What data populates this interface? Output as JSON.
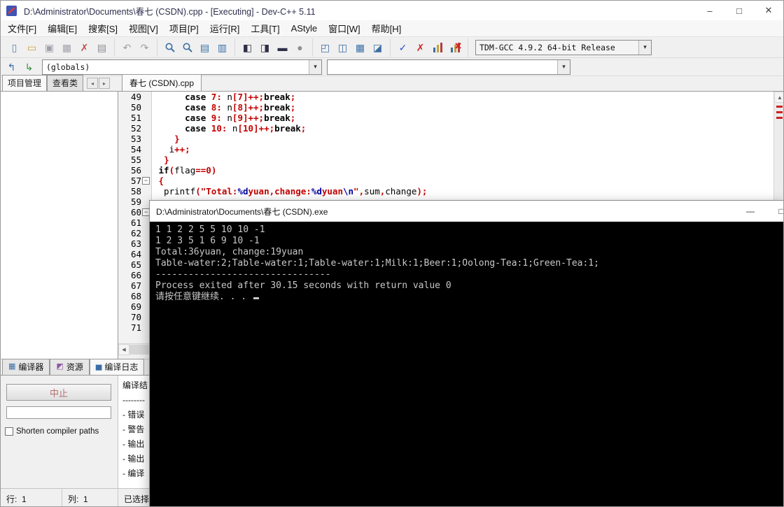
{
  "window": {
    "title": "D:\\Administrator\\Documents\\春七 (CSDN).cpp - [Executing] - Dev-C++ 5.11",
    "minimize": "–",
    "maximize": "□",
    "close": "✕"
  },
  "menu": {
    "items": [
      "文件[F]",
      "编辑[E]",
      "搜索[S]",
      "视图[V]",
      "项目[P]",
      "运行[R]",
      "工具[T]",
      "AStyle",
      "窗口[W]",
      "帮助[H]"
    ]
  },
  "toolbar": {
    "groups": [
      {
        "items": [
          {
            "name": "new-source-icon",
            "glyph": "▯",
            "color": "#5a80a8"
          },
          {
            "name": "open-file-icon",
            "glyph": "▭",
            "color": "#c9a13b"
          },
          {
            "name": "save-icon",
            "glyph": "▣",
            "color": "#a0a0a8"
          },
          {
            "name": "save-all-icon",
            "glyph": "▦",
            "color": "#a0a0a8"
          },
          {
            "name": "close-file-icon",
            "glyph": "✗",
            "color": "#c05050"
          },
          {
            "name": "print-icon",
            "glyph": "▤",
            "color": "#8a8a92"
          }
        ]
      },
      {
        "items": [
          {
            "name": "undo-icon",
            "glyph": "↶",
            "color": "#9aa0a8"
          },
          {
            "name": "redo-icon",
            "glyph": "↷",
            "color": "#9aa0a8"
          }
        ]
      },
      {
        "items": [
          {
            "name": "find-icon",
            "svg": "magnifier",
            "color": "#3a6ea5"
          },
          {
            "name": "replace-icon",
            "svg": "magnifier",
            "color": "#3a6ea5"
          },
          {
            "name": "goto-line-icon",
            "glyph": "▤",
            "color": "#3a6ea5"
          },
          {
            "name": "incremental-search-icon",
            "glyph": "▥",
            "color": "#3a6ea5"
          }
        ]
      },
      {
        "items": [
          {
            "name": "compile-icon",
            "glyph": "◧",
            "color": "#2f2f49"
          },
          {
            "name": "run-icon",
            "glyph": "◨",
            "color": "#2f2f49"
          },
          {
            "name": "compile-run-icon",
            "glyph": "▬",
            "color": "#2f2f49"
          },
          {
            "name": "debug-icon",
            "glyph": "●",
            "color": "#8f9096"
          }
        ]
      },
      {
        "items": [
          {
            "name": "new-project-icon",
            "glyph": "◰",
            "color": "#3a6ea5"
          },
          {
            "name": "open-project-icon",
            "glyph": "◫",
            "color": "#3a6ea5"
          },
          {
            "name": "project-options-icon",
            "glyph": "▦",
            "color": "#3a6ea5"
          },
          {
            "name": "package-manager-icon",
            "glyph": "◪",
            "color": "#3a6ea5"
          }
        ]
      },
      {
        "items": [
          {
            "name": "syntax-check-icon",
            "glyph": "✓",
            "color": "#2a52c8"
          },
          {
            "name": "abort-compile-icon",
            "glyph": "✗",
            "color": "#d42222"
          },
          {
            "name": "profile-icon",
            "svg": "chart",
            "color": "#3a6ea5"
          },
          {
            "name": "delete-profile-icon",
            "svg": "chart-x",
            "color": "#3a6ea5"
          }
        ]
      }
    ],
    "compiler_combo": {
      "value": "TDM-GCC 4.9.2 64-bit Release",
      "arrow": "▾"
    }
  },
  "nav": {
    "icons": [
      {
        "name": "goto-declaration-icon",
        "glyph": "↰",
        "color": "#3a6ea5"
      },
      {
        "name": "goto-definition-icon",
        "glyph": "↳",
        "color": "#2f8f3a"
      }
    ],
    "globals_combo": "(globals)",
    "member_combo": "",
    "arrow": "▾"
  },
  "left_panel": {
    "tabs": [
      {
        "name": "tab-project-manager",
        "label": "项目管理",
        "active": true
      },
      {
        "name": "tab-class-browser",
        "label": "查看类",
        "active": false
      }
    ],
    "arrows": [
      "◂",
      "▸"
    ]
  },
  "editor": {
    "tab": "春七 (CSDN).cpp",
    "scroll_up": "▲",
    "scroll_left": "◀",
    "lines": [
      {
        "num": 49,
        "segs": [
          [
            "pl",
            "      "
          ],
          [
            "kw",
            "case"
          ],
          [
            "pl",
            " "
          ],
          [
            "num",
            "7"
          ],
          [
            "sym",
            ":"
          ],
          [
            "pl",
            " n"
          ],
          [
            "sym",
            "["
          ],
          [
            "num",
            "7"
          ],
          [
            "sym",
            "]++;"
          ],
          [
            "kw",
            "break"
          ],
          [
            "sym",
            ";"
          ]
        ]
      },
      {
        "num": 50,
        "segs": [
          [
            "pl",
            "      "
          ],
          [
            "kw",
            "case"
          ],
          [
            "pl",
            " "
          ],
          [
            "num",
            "8"
          ],
          [
            "sym",
            ":"
          ],
          [
            "pl",
            " n"
          ],
          [
            "sym",
            "["
          ],
          [
            "num",
            "8"
          ],
          [
            "sym",
            "]++;"
          ],
          [
            "kw",
            "break"
          ],
          [
            "sym",
            ";"
          ]
        ]
      },
      {
        "num": 51,
        "segs": [
          [
            "pl",
            "      "
          ],
          [
            "kw",
            "case"
          ],
          [
            "pl",
            " "
          ],
          [
            "num",
            "9"
          ],
          [
            "sym",
            ":"
          ],
          [
            "pl",
            " n"
          ],
          [
            "sym",
            "["
          ],
          [
            "num",
            "9"
          ],
          [
            "sym",
            "]++;"
          ],
          [
            "kw",
            "break"
          ],
          [
            "sym",
            ";"
          ]
        ]
      },
      {
        "num": 52,
        "segs": [
          [
            "pl",
            "      "
          ],
          [
            "kw",
            "case"
          ],
          [
            "pl",
            " "
          ],
          [
            "num",
            "10"
          ],
          [
            "sym",
            ":"
          ],
          [
            "pl",
            " n"
          ],
          [
            "sym",
            "["
          ],
          [
            "num",
            "10"
          ],
          [
            "sym",
            "]++;"
          ],
          [
            "kw",
            "break"
          ],
          [
            "sym",
            ";"
          ]
        ]
      },
      {
        "num": 53,
        "segs": [
          [
            "pl",
            "    "
          ],
          [
            "sym",
            "}"
          ]
        ]
      },
      {
        "num": 54,
        "segs": [
          [
            "pl",
            "   i"
          ],
          [
            "sym",
            "++;"
          ]
        ]
      },
      {
        "num": 55,
        "segs": [
          [
            "pl",
            "  "
          ],
          [
            "sym",
            "}"
          ]
        ]
      },
      {
        "num": 56,
        "segs": [
          [
            "pl",
            " "
          ],
          [
            "kw",
            "if"
          ],
          [
            "sym",
            "("
          ],
          [
            "pl",
            "flag"
          ],
          [
            "sym",
            "=="
          ],
          [
            "num",
            "0"
          ],
          [
            "sym",
            ")"
          ]
        ]
      },
      {
        "num": 57,
        "fold": "−",
        "segs": [
          [
            "pl",
            " "
          ],
          [
            "sym",
            "{"
          ]
        ]
      },
      {
        "num": 58,
        "segs": [
          [
            "pl",
            "  printf"
          ],
          [
            "sym",
            "("
          ],
          [
            "str",
            "\"Total:"
          ],
          [
            "fmt",
            "%d"
          ],
          [
            "str",
            "yuan,change:"
          ],
          [
            "fmt",
            "%d"
          ],
          [
            "str",
            "yuan"
          ],
          [
            "fmt",
            "\\n"
          ],
          [
            "str",
            "\""
          ],
          [
            "sym",
            ","
          ],
          [
            "pl",
            "sum"
          ],
          [
            "sym",
            ","
          ],
          [
            "pl",
            "change"
          ],
          [
            "sym",
            ")"
          ],
          [
            "sym",
            ";"
          ]
        ]
      },
      {
        "num": 59,
        "segs": []
      },
      {
        "num": 60,
        "fold": "−",
        "segs": []
      },
      {
        "num": 61,
        "segs": []
      },
      {
        "num": 62,
        "segs": []
      },
      {
        "num": 63,
        "segs": []
      },
      {
        "num": 64,
        "segs": []
      },
      {
        "num": 65,
        "segs": []
      },
      {
        "num": 66,
        "segs": []
      },
      {
        "num": 67,
        "segs": []
      },
      {
        "num": 68,
        "segs": []
      },
      {
        "num": 69,
        "segs": []
      },
      {
        "num": 70,
        "segs": []
      },
      {
        "num": 71,
        "segs": []
      }
    ]
  },
  "console": {
    "title": "D:\\Administrator\\Documents\\春七 (CSDN).exe",
    "minimize": "—",
    "maximize": "□",
    "lines": [
      "1 1 2 2 5 5 10 10 -1",
      "1 2 3 5 1 6 9 10 -1",
      "Total:36yuan, change:19yuan",
      "Table-water:2;Table-water:1;Table-water:1;Milk:1;Beer:1;Oolong-Tea:1;Green-Tea:1;",
      "--------------------------------",
      "Process exited after 30.15 seconds with return value 0",
      "请按任意键继续. . . "
    ]
  },
  "bottom": {
    "tabs": [
      {
        "name": "tab-compiler",
        "label": "编译器",
        "icon": "▦",
        "color": "#3a6ea5",
        "active": false
      },
      {
        "name": "tab-resources",
        "label": "资源",
        "icon": "◩",
        "color": "#8a5aa0",
        "active": false
      },
      {
        "name": "tab-compile-log",
        "label": "编译日志",
        "icon": "▅",
        "color": "#3a6ea5",
        "active": true
      }
    ],
    "abort_label": "中止",
    "checkbox_label": "Shorten compiler paths",
    "log_lines": [
      "编译结",
      "--------",
      "- 错误",
      "- 警告",
      "- 输出",
      "- 输出",
      "- 编译"
    ]
  },
  "statusbar": {
    "cells": [
      {
        "name": "status-line",
        "text": "行:  1"
      },
      {
        "name": "status-column",
        "text": "列:  1"
      },
      {
        "name": "status-selection",
        "text": "已选择"
      }
    ]
  }
}
